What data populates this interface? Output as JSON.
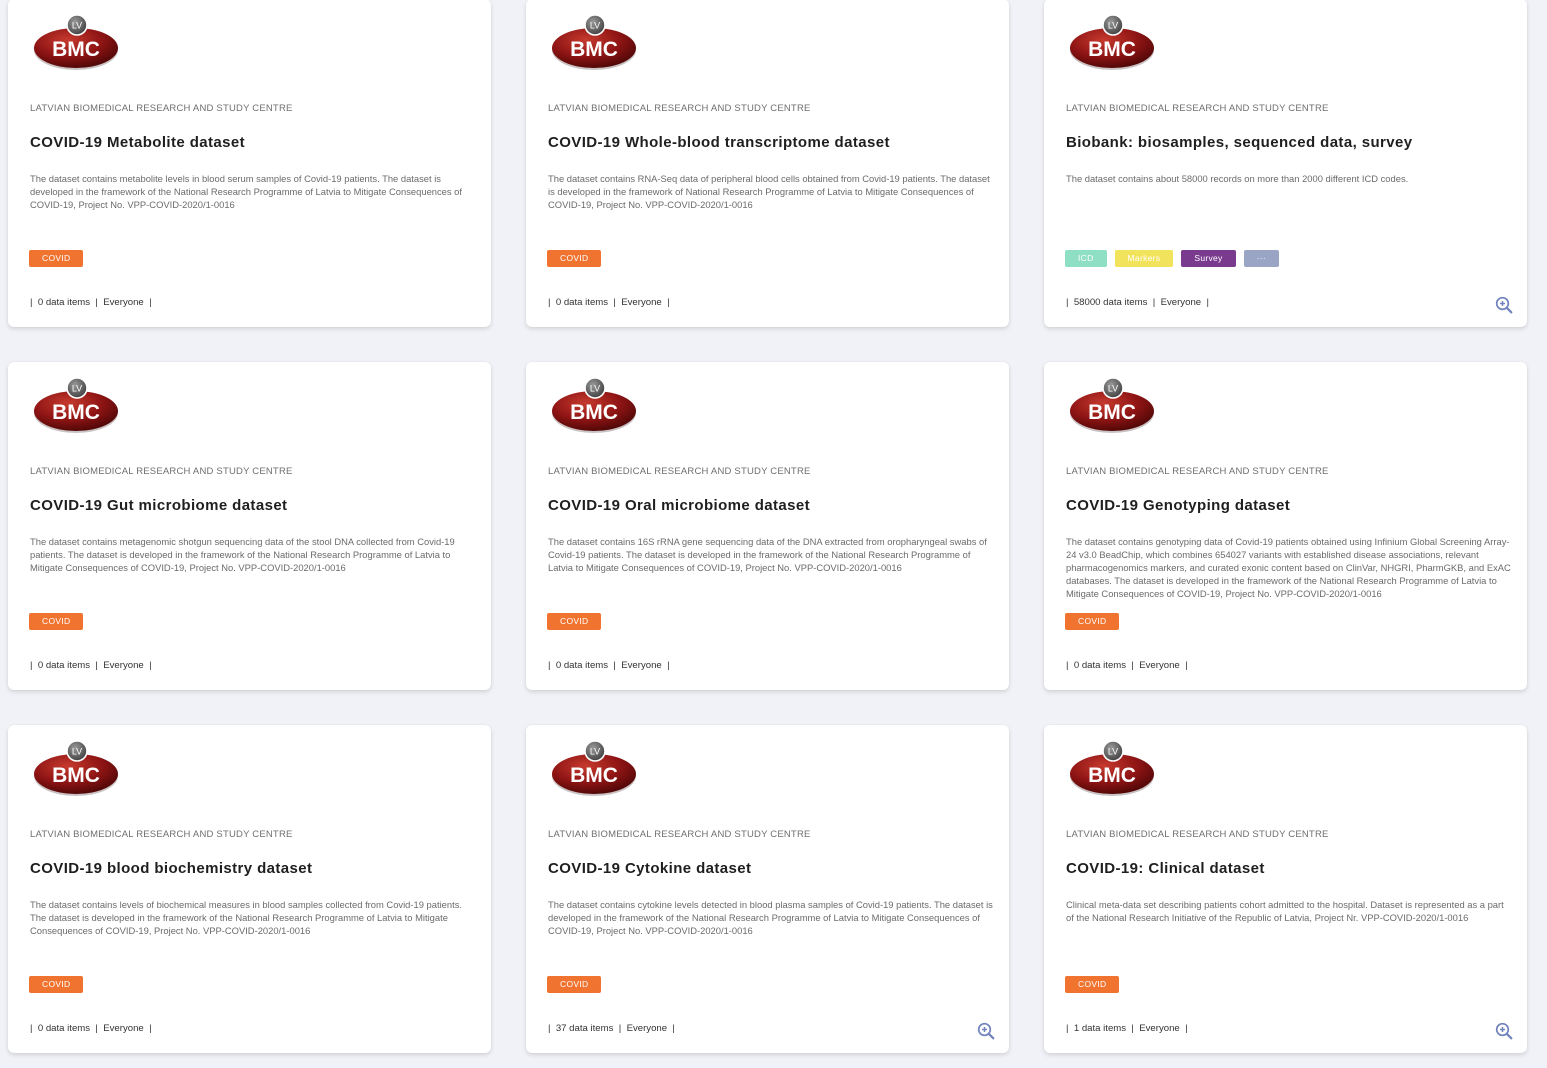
{
  "colors": {
    "background": "#f1f2f7",
    "card": "#ffffff",
    "covid": "#f07430",
    "icd": "#8fdfc4",
    "markers": "#f2e35c",
    "survey": "#7a3b8f",
    "more": "#9aa4c4",
    "zoom_icon": "#7183bd",
    "logo_red": "#8e1414"
  },
  "logo": {
    "badge": "LV",
    "text": "BMC"
  },
  "cards": [
    {
      "org": "LATVIAN BIOMEDICAL RESEARCH AND STUDY CENTRE",
      "title": "COVID-19 Metabolite dataset",
      "description": "The dataset contains metabolite levels in blood serum samples of Covid-19 patients. The dataset is developed in the framework of the National Research Programme of Latvia to Mitigate Consequences of COVID-19, Project No. VPP-COVID-2020/1-0016",
      "tags": [
        {
          "label": "COVID",
          "color": "covid"
        }
      ],
      "meta": "|  0 data items  |  Everyone  |",
      "zoom": false
    },
    {
      "org": "LATVIAN BIOMEDICAL RESEARCH AND STUDY CENTRE",
      "title": "COVID-19 Whole-blood transcriptome dataset",
      "description": "The dataset contains RNA-Seq data of peripheral blood cells obtained from Covid-19 patients. The dataset is developed in the framework of National Research Programme of Latvia to Mitigate Consequences of COVID-19, Project No. VPP-COVID-2020/1-0016",
      "tags": [
        {
          "label": "COVID",
          "color": "covid"
        }
      ],
      "meta": "|  0 data items  |  Everyone  |",
      "zoom": false
    },
    {
      "org": "LATVIAN BIOMEDICAL RESEARCH AND STUDY CENTRE",
      "title": "Biobank: biosamples, sequenced data, survey",
      "description": "The dataset contains about 58000 records on more than 2000 different ICD codes.",
      "tags": [
        {
          "label": "ICD",
          "color": "icd"
        },
        {
          "label": "Markers",
          "color": "markers"
        },
        {
          "label": "Survey",
          "color": "survey"
        },
        {
          "label": "···",
          "color": "more"
        }
      ],
      "meta": "|  58000 data items  |  Everyone  |",
      "zoom": true
    },
    {
      "org": "LATVIAN BIOMEDICAL RESEARCH AND STUDY CENTRE",
      "title": "COVID-19 Gut microbiome dataset",
      "description": "The dataset contains metagenomic shotgun sequencing data of the stool DNA collected from Covid-19 patients. The dataset is developed in the framework of the National Research Programme of Latvia to Mitigate Consequences of COVID-19, Project No. VPP-COVID-2020/1-0016",
      "tags": [
        {
          "label": "COVID",
          "color": "covid"
        }
      ],
      "meta": "|  0 data items  |  Everyone  |",
      "zoom": false
    },
    {
      "org": "LATVIAN BIOMEDICAL RESEARCH AND STUDY CENTRE",
      "title": "COVID-19 Oral microbiome dataset",
      "description": "The dataset contains 16S rRNA gene sequencing data of the DNA extracted from oropharyngeal swabs of Covid-19 patients. The dataset is developed in the framework of the National Research Programme of Latvia to Mitigate Consequences of COVID-19, Project No. VPP-COVID-2020/1-0016",
      "tags": [
        {
          "label": "COVID",
          "color": "covid"
        }
      ],
      "meta": "|  0 data items  |  Everyone  |",
      "zoom": false
    },
    {
      "org": "LATVIAN BIOMEDICAL RESEARCH AND STUDY CENTRE",
      "title": "COVID-19 Genotyping dataset",
      "description": "The dataset contains genotyping data of Covid-19 patients obtained using Infinium Global Screening Array-24 v3.0 BeadChip, which combines 654027 variants with established disease associations, relevant pharmacogenomics markers, and curated exonic content based on ClinVar, NHGRI, PharmGKB, and ExAC databases. The dataset is developed in the framework of the National Research Programme of Latvia to Mitigate Consequences of COVID-19, Project No. VPP-COVID-2020/1-0016",
      "tags": [
        {
          "label": "COVID",
          "color": "covid"
        }
      ],
      "meta": "|  0 data items  |  Everyone  |",
      "zoom": false
    },
    {
      "org": "LATVIAN BIOMEDICAL RESEARCH AND STUDY CENTRE",
      "title": "COVID-19 blood biochemistry dataset",
      "description": "The dataset contains levels of biochemical measures in blood samples collected from Covid-19 patients. The dataset is developed in the framework of the National Research Programme of Latvia to Mitigate Consequences of COVID-19, Project No. VPP-COVID-2020/1-0016",
      "tags": [
        {
          "label": "COVID",
          "color": "covid"
        }
      ],
      "meta": "|  0 data items  |  Everyone  |",
      "zoom": false
    },
    {
      "org": "LATVIAN BIOMEDICAL RESEARCH AND STUDY CENTRE",
      "title": "COVID-19 Cytokine dataset",
      "description": "The dataset contains cytokine levels detected in blood plasma samples of Covid-19 patients. The dataset is developed in the framework of the National Research Programme of Latvia to Mitigate Consequences of COVID-19, Project No. VPP-COVID-2020/1-0016",
      "tags": [
        {
          "label": "COVID",
          "color": "covid"
        }
      ],
      "meta": "|  37 data items  |  Everyone  |",
      "zoom": true
    },
    {
      "org": "LATVIAN BIOMEDICAL RESEARCH AND STUDY CENTRE",
      "title": "COVID-19: Clinical dataset",
      "description": "Clinical meta-data set describing patients cohort admitted to the hospital. Dataset is represented as a part of the National Research Initiative of the Republic of Latvia, Project Nr. VPP-COVID-2020/1-0016",
      "tags": [
        {
          "label": "COVID",
          "color": "covid"
        }
      ],
      "meta": "|  1 data items  |  Everyone  |",
      "zoom": true
    }
  ]
}
